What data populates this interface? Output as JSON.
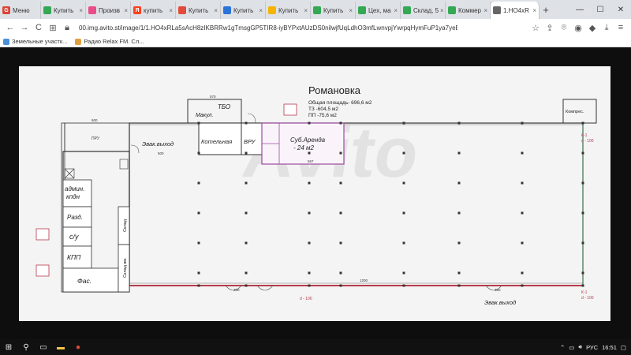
{
  "browser": {
    "tabs": [
      {
        "label": "Меню",
        "favicon": "G",
        "favicon_color": "#db4437",
        "close": ""
      },
      {
        "label": "Купить",
        "favicon": "",
        "favicon_color": "#34a853",
        "close": "×"
      },
      {
        "label": "Произв",
        "favicon": "",
        "favicon_color": "#ea4c89",
        "close": "×"
      },
      {
        "label": "купить",
        "favicon": "Я",
        "favicon_color": "#fc3f1d",
        "close": "×"
      },
      {
        "label": "Купить",
        "favicon": "",
        "favicon_color": "#e24a3b",
        "close": "×"
      },
      {
        "label": "Купить",
        "favicon": "",
        "favicon_color": "#2b74d9",
        "close": "×"
      },
      {
        "label": "Купить",
        "favicon": "",
        "favicon_color": "#f4b400",
        "close": "×"
      },
      {
        "label": "Купить",
        "favicon": "",
        "favicon_color": "#34a853",
        "close": "×"
      },
      {
        "label": "Цех, ма",
        "favicon": "",
        "favicon_color": "#34a853",
        "close": "×"
      },
      {
        "label": "Склад, 5",
        "favicon": "",
        "favicon_color": "#34a853",
        "close": "×"
      },
      {
        "label": "Коммер",
        "favicon": "",
        "favicon_color": "#34a853",
        "close": "×"
      },
      {
        "label": "1.HO4xR",
        "favicon": "",
        "favicon_color": "#666666",
        "close": "×",
        "active": true
      }
    ],
    "new_tab": "+",
    "window_controls": {
      "minimize": "—",
      "maximize": "☐",
      "close": "✕"
    },
    "url": "00.img.avito.st/image/1/1.HO4xRLa5sAcH8zIKBRRw1gTmsgGP5TIR8-iyBYPxtAUzDS0nilwjfUqLdhO3mfLwnvpjYwrpqHymFuP1ya7yeE",
    "bookmarks": [
      {
        "label": "Земельные участк...",
        "color": "#4a90d9"
      },
      {
        "label": "Радио Relax FM. Сл...",
        "color": "#e0a040"
      }
    ]
  },
  "plan": {
    "title": "Романовка",
    "area_total": "Общая площадь- 696,6 м2",
    "area_tz": "ТЗ -604,5 м2",
    "area_pp": "ПП -75,6 м2",
    "sub_rent_line1": "Суб.Аренда",
    "sub_rent_line2": "- 24 м2",
    "rooms": {
      "tbo": "ТБО",
      "makul": "Макул.",
      "kotelnaya": "Котельная",
      "vru": "ВРУ",
      "admin1": "админ.",
      "admin2": "кпдн",
      "razd": "Разд.",
      "su": "с/у",
      "kpp": "КПП",
      "fas": "Фас.",
      "sklad": "Склад",
      "sklad_vm": "Склад вм.",
      "kompres": "Компрес.",
      "pru": "ПРУ"
    },
    "labels": {
      "evak_top": "Эвак.выход",
      "evak_bottom": "Эвак.выход",
      "k1_top": "К-1",
      "d100_top": "d - 100",
      "k1_bottom": "К-1",
      "d100_bottom": "d - 100",
      "d100_mid": "d - 100",
      "dim_1200": "1200",
      "dim_600": "600",
      "dim_570": "570",
      "dim_567": "567",
      "dim_500": "500",
      "dim_300": "300",
      "dim_360": "360"
    },
    "watermark": "Avito"
  },
  "taskbar": {
    "tray_lang": "РУС",
    "tray_time": "16:51"
  }
}
